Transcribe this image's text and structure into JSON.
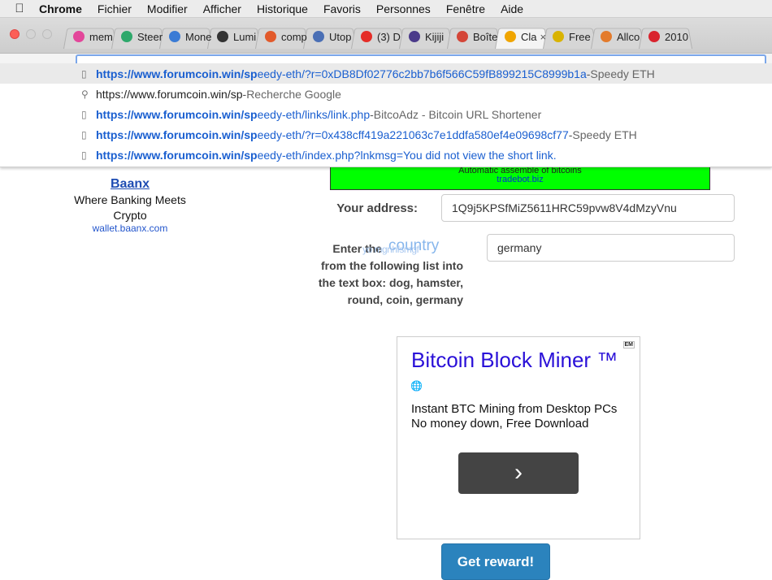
{
  "menubar": {
    "app": "Chrome",
    "items": [
      "Fichier",
      "Modifier",
      "Afficher",
      "Historique",
      "Favoris",
      "Personnes",
      "Fenêtre",
      "Aide"
    ]
  },
  "tabs": [
    {
      "title": "mem",
      "color": "#e3469a",
      "icon": "colorful-circle-icon"
    },
    {
      "title": "Steer",
      "color": "#2ea86b",
      "icon": "steem-icon"
    },
    {
      "title": "Mone",
      "color": "#3a7bd5",
      "icon": "m-logo-icon"
    },
    {
      "title": "Lumi",
      "color": "#333333",
      "icon": "lightning-icon"
    },
    {
      "title": "comp",
      "color": "#e25a2b",
      "icon": "d-logo-icon"
    },
    {
      "title": "Utop",
      "color": "#4a6fb5",
      "icon": "eye-icon"
    },
    {
      "title": "(3) D",
      "color": "#e52d27",
      "icon": "youtube-icon"
    },
    {
      "title": "Kijiji",
      "color": "#4b3a8a",
      "icon": "k-logo-icon"
    },
    {
      "title": "Boîte",
      "color": "#d44638",
      "icon": "gmail-icon"
    },
    {
      "title": "Cla",
      "color": "#f0a500",
      "icon": "bitcoin-icon",
      "active": true
    },
    {
      "title": "Free",
      "color": "#d9b300",
      "icon": "coin-icon"
    },
    {
      "title": "Allco",
      "color": "#e37b2c",
      "icon": "allcoin-icon"
    },
    {
      "title": "2010",
      "color": "#d9232d",
      "icon": "play-icon"
    }
  ],
  "dropdown": [
    {
      "icon": "page-icon",
      "bold": "https://www.forumcoin.win/sp",
      "rest": "eedy-eth/?r=0xDB8Df02776c2bb7b6f566C59fB899215C8999b1a",
      "desc": "Speedy ETH",
      "selected": true
    },
    {
      "icon": "search-icon",
      "plain": "https://www.forumcoin.win/sp",
      "desc": "Recherche Google"
    },
    {
      "icon": "page-icon",
      "bold": "https://www.forumcoin.win/sp",
      "rest": "eedy-eth/links/link.php",
      "desc": "BitcoAdz - Bitcoin URL Shortener"
    },
    {
      "icon": "page-icon",
      "bold": "https://www.forumcoin.win/sp",
      "rest": "eedy-eth/?r=0x438cff419a221063c7e1ddfa580ef4e09698cf77",
      "desc": "Speedy ETH"
    },
    {
      "icon": "page-icon",
      "bold": "https://www.forumcoin.win/sp",
      "rest": "eedy-eth/index.php?lnkmsg=You did not view the short link.",
      "desc": ""
    }
  ],
  "page": {
    "green_ad": {
      "text": "Automatic assemble of bitcoins",
      "link": "tradebot.biz"
    },
    "baanx": {
      "title": "Baanx",
      "line1": "Where Banking Meets",
      "line2": "Crypto",
      "link": "wallet.baanx.com"
    },
    "address_label": "Your address:",
    "address_value": "1Q9j5KPSfMiZ5611HRC59pvw8V4dMzyVnu",
    "instructions": {
      "line1": "Enter the",
      "line2": "from the following list into",
      "line3": "the text box: dog, hamster,",
      "line4": "round, coin, germany",
      "overlay_word": "country",
      "overlay_noise": "yo mgnhfsmgf"
    },
    "country_value": "germany",
    "ad": {
      "em": "EM",
      "headline": "Bitcoin Block Miner ™",
      "body1": "Instant BTC Mining from Desktop PCs",
      "body2": "No money down, Free Download",
      "button": "›"
    },
    "reward_button": "Get reward!"
  }
}
